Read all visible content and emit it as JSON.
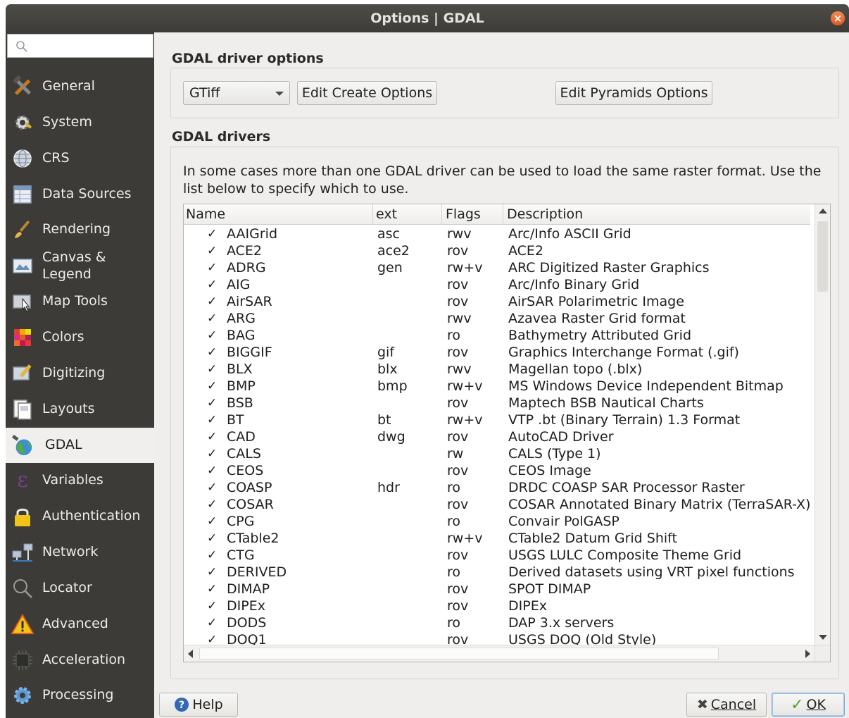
{
  "window": {
    "title": "Options | GDAL"
  },
  "search": {
    "placeholder": ""
  },
  "sidebar": {
    "items": [
      {
        "id": "general",
        "label": "General",
        "icon": "hammer-wrench-icon"
      },
      {
        "id": "system",
        "label": "System",
        "icon": "system-gear-icon"
      },
      {
        "id": "crs",
        "label": "CRS",
        "icon": "globe-grid-icon"
      },
      {
        "id": "data-sources",
        "label": "Data Sources",
        "icon": "table-icon"
      },
      {
        "id": "rendering",
        "label": "Rendering",
        "icon": "paintbrush-icon"
      },
      {
        "id": "canvas-legend",
        "label": "Canvas & Legend",
        "icon": "map-canvas-icon"
      },
      {
        "id": "map-tools",
        "label": "Map Tools",
        "icon": "map-tools-icon"
      },
      {
        "id": "colors",
        "label": "Colors",
        "icon": "color-grid-icon"
      },
      {
        "id": "digitizing",
        "label": "Digitizing",
        "icon": "digitizing-pencil-icon"
      },
      {
        "id": "layouts",
        "label": "Layouts",
        "icon": "layout-pages-icon"
      },
      {
        "id": "gdal",
        "label": "GDAL",
        "icon": "gdal-globe-icon"
      },
      {
        "id": "variables",
        "label": "Variables",
        "icon": "epsilon-icon"
      },
      {
        "id": "authentication",
        "label": "Authentication",
        "icon": "padlock-icon"
      },
      {
        "id": "network",
        "label": "Network",
        "icon": "network-computers-icon"
      },
      {
        "id": "locator",
        "label": "Locator",
        "icon": "magnifier-icon"
      },
      {
        "id": "advanced",
        "label": "Advanced",
        "icon": "warning-icon"
      },
      {
        "id": "acceleration",
        "label": "Acceleration",
        "icon": "chip-icon"
      },
      {
        "id": "processing",
        "label": "Processing",
        "icon": "processing-gear-icon"
      }
    ],
    "active": "GDAL"
  },
  "driver_options": {
    "title": "GDAL driver options",
    "selected_driver": "GTiff",
    "edit_create_label": "Edit Create Options",
    "edit_pyramids_label": "Edit Pyramids Options"
  },
  "drivers": {
    "title": "GDAL drivers",
    "description": "In some cases more than one GDAL driver can be used to load the same raster format. Use the list below to specify which to use.",
    "columns": [
      "Name",
      "ext",
      "Flags",
      "Description"
    ],
    "check_glyph": "✓",
    "rows": [
      {
        "name": "AAIGrid",
        "ext": "asc",
        "flags": "rwv",
        "desc": "Arc/Info ASCII Grid"
      },
      {
        "name": "ACE2",
        "ext": "ace2",
        "flags": "rov",
        "desc": "ACE2"
      },
      {
        "name": "ADRG",
        "ext": "gen",
        "flags": "rw+v",
        "desc": "ARC Digitized Raster Graphics"
      },
      {
        "name": "AIG",
        "ext": "",
        "flags": "rov",
        "desc": "Arc/Info Binary Grid"
      },
      {
        "name": "AirSAR",
        "ext": "",
        "flags": "rov",
        "desc": "AirSAR Polarimetric Image"
      },
      {
        "name": "ARG",
        "ext": "",
        "flags": "rwv",
        "desc": "Azavea Raster Grid format"
      },
      {
        "name": "BAG",
        "ext": "",
        "flags": "ro",
        "desc": "Bathymetry Attributed Grid"
      },
      {
        "name": "BIGGIF",
        "ext": "gif",
        "flags": "rov",
        "desc": "Graphics Interchange Format (.gif)"
      },
      {
        "name": "BLX",
        "ext": "blx",
        "flags": "rwv",
        "desc": "Magellan topo (.blx)"
      },
      {
        "name": "BMP",
        "ext": "bmp",
        "flags": "rw+v",
        "desc": "MS Windows Device Independent Bitmap"
      },
      {
        "name": "BSB",
        "ext": "",
        "flags": "rov",
        "desc": "Maptech BSB Nautical Charts"
      },
      {
        "name": "BT",
        "ext": "bt",
        "flags": "rw+v",
        "desc": "VTP .bt (Binary Terrain) 1.3 Format"
      },
      {
        "name": "CAD",
        "ext": "dwg",
        "flags": "rov",
        "desc": "AutoCAD Driver"
      },
      {
        "name": "CALS",
        "ext": "",
        "flags": "rw",
        "desc": "CALS (Type 1)"
      },
      {
        "name": "CEOS",
        "ext": "",
        "flags": "rov",
        "desc": "CEOS Image"
      },
      {
        "name": "COASP",
        "ext": "hdr",
        "flags": "ro",
        "desc": "DRDC COASP SAR Processor Raster"
      },
      {
        "name": "COSAR",
        "ext": "",
        "flags": "rov",
        "desc": "COSAR Annotated Binary Matrix (TerraSAR-X)"
      },
      {
        "name": "CPG",
        "ext": "",
        "flags": "ro",
        "desc": "Convair PolGASP"
      },
      {
        "name": "CTable2",
        "ext": "",
        "flags": "rw+v",
        "desc": "CTable2 Datum Grid Shift"
      },
      {
        "name": "CTG",
        "ext": "",
        "flags": "rov",
        "desc": "USGS LULC Composite Theme Grid"
      },
      {
        "name": "DERIVED",
        "ext": "",
        "flags": "ro",
        "desc": "Derived datasets using VRT pixel functions"
      },
      {
        "name": "DIMAP",
        "ext": "",
        "flags": "rov",
        "desc": "SPOT DIMAP"
      },
      {
        "name": "DIPEx",
        "ext": "",
        "flags": "rov",
        "desc": "DIPEx"
      },
      {
        "name": "DODS",
        "ext": "",
        "flags": "ro",
        "desc": "DAP 3.x servers"
      },
      {
        "name": "DOQ1",
        "ext": "",
        "flags": "rov",
        "desc": "USGS DOQ (Old Style)"
      }
    ]
  },
  "buttons": {
    "help": "Help",
    "cancel": "Cancel",
    "ok": "OK"
  },
  "colors": {
    "sidebar_bg": "#3c3b37",
    "titlebar_bg": "#3d3c38",
    "close_button": "#e5652e",
    "window_bg": "#efeeec"
  }
}
